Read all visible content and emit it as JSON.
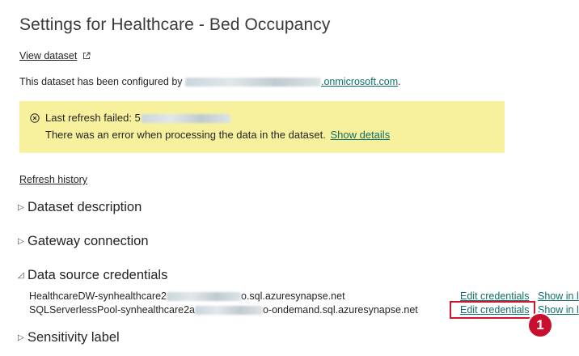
{
  "page": {
    "title": "Settings for Healthcare - Bed Occupancy"
  },
  "view_dataset": {
    "label": "View dataset",
    "icon": "external-link-icon"
  },
  "configured": {
    "prefix": "This dataset has been configured by ",
    "email_suffix": ".onmicrosoft.com",
    "period": "."
  },
  "error_banner": {
    "icon": "error-circle-icon",
    "failed_prefix": "Last refresh failed: 5",
    "message": "There was an error when processing the data in the dataset. ",
    "show_details": "Show details",
    "background": "#f7f19e"
  },
  "refresh_history": "Refresh history",
  "sections": {
    "dataset_description": "Dataset description",
    "gateway_connection": "Gateway connection",
    "data_source_credentials": "Data source credentials",
    "sensitivity_label": "Sensitivity label"
  },
  "credentials": [
    {
      "name_prefix": "HealthcareDW-synhealthcare2",
      "name_suffix": "o.sql.azuresynapse.net",
      "edit": "Edit credentials",
      "show": "Show in l"
    },
    {
      "name_prefix": "SQLServerlessPool-synhealthcare2a",
      "name_suffix": "o-ondemand.sql.azuresynapse.net",
      "edit": "Edit credentials",
      "show": "Show in l"
    }
  ],
  "annotation": {
    "step": "1",
    "color": "#c8102e"
  },
  "colors": {
    "link": "#0e6e6a",
    "text": "#252423"
  }
}
